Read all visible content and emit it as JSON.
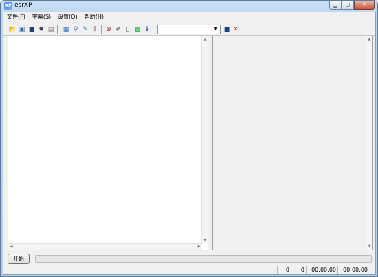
{
  "window": {
    "title": "esrXP"
  },
  "menu": {
    "items": [
      "文件(F)",
      "字幕(S)",
      "设置(O)",
      "帮助(H)"
    ]
  },
  "toolbar": {
    "buttons": [
      {
        "name": "open-icon",
        "glyph": "📂",
        "color": "#d9a520"
      },
      {
        "name": "save-all-icon",
        "glyph": "▣",
        "color": "#2d5fa8"
      },
      {
        "name": "save-icon",
        "glyph": "■",
        "color": "#1f3f7a"
      },
      {
        "name": "settings-icon",
        "glyph": "✹",
        "color": "#444444"
      },
      {
        "name": "clipboard-icon",
        "glyph": "▤",
        "color": "#6b6b6b"
      },
      {
        "name": "subtitle-icon",
        "glyph": "▦",
        "color": "#2e6fc2"
      },
      {
        "name": "search-icon",
        "glyph": "⚲",
        "color": "#3b6cb4"
      },
      {
        "name": "edit-doc-icon",
        "glyph": "✎",
        "color": "#3f7ed1"
      },
      {
        "name": "export-icon",
        "glyph": "⇩",
        "color": "#555555"
      },
      {
        "name": "zoom-in-icon",
        "glyph": "⊕",
        "color": "#b02a2a"
      },
      {
        "name": "pen-icon",
        "glyph": "✐",
        "color": "#333333"
      },
      {
        "name": "document-icon",
        "glyph": "▯",
        "color": "#555555"
      },
      {
        "name": "color-palette-icon",
        "glyph": "▩",
        "color": "#2aa84a"
      },
      {
        "name": "info-icon",
        "glyph": "ℹ",
        "color": "#2a5fb0"
      }
    ],
    "combo_value": "",
    "combo_save_icon": {
      "glyph": "■",
      "color": "#1f3f7a"
    },
    "combo_delete_icon": {
      "glyph": "✕",
      "color": "#d23a2a"
    }
  },
  "controls": {
    "start_label": "开始",
    "progress": 0
  },
  "status": {
    "cells": [
      "0",
      "0",
      "00:00:00",
      "00:00:00"
    ]
  }
}
